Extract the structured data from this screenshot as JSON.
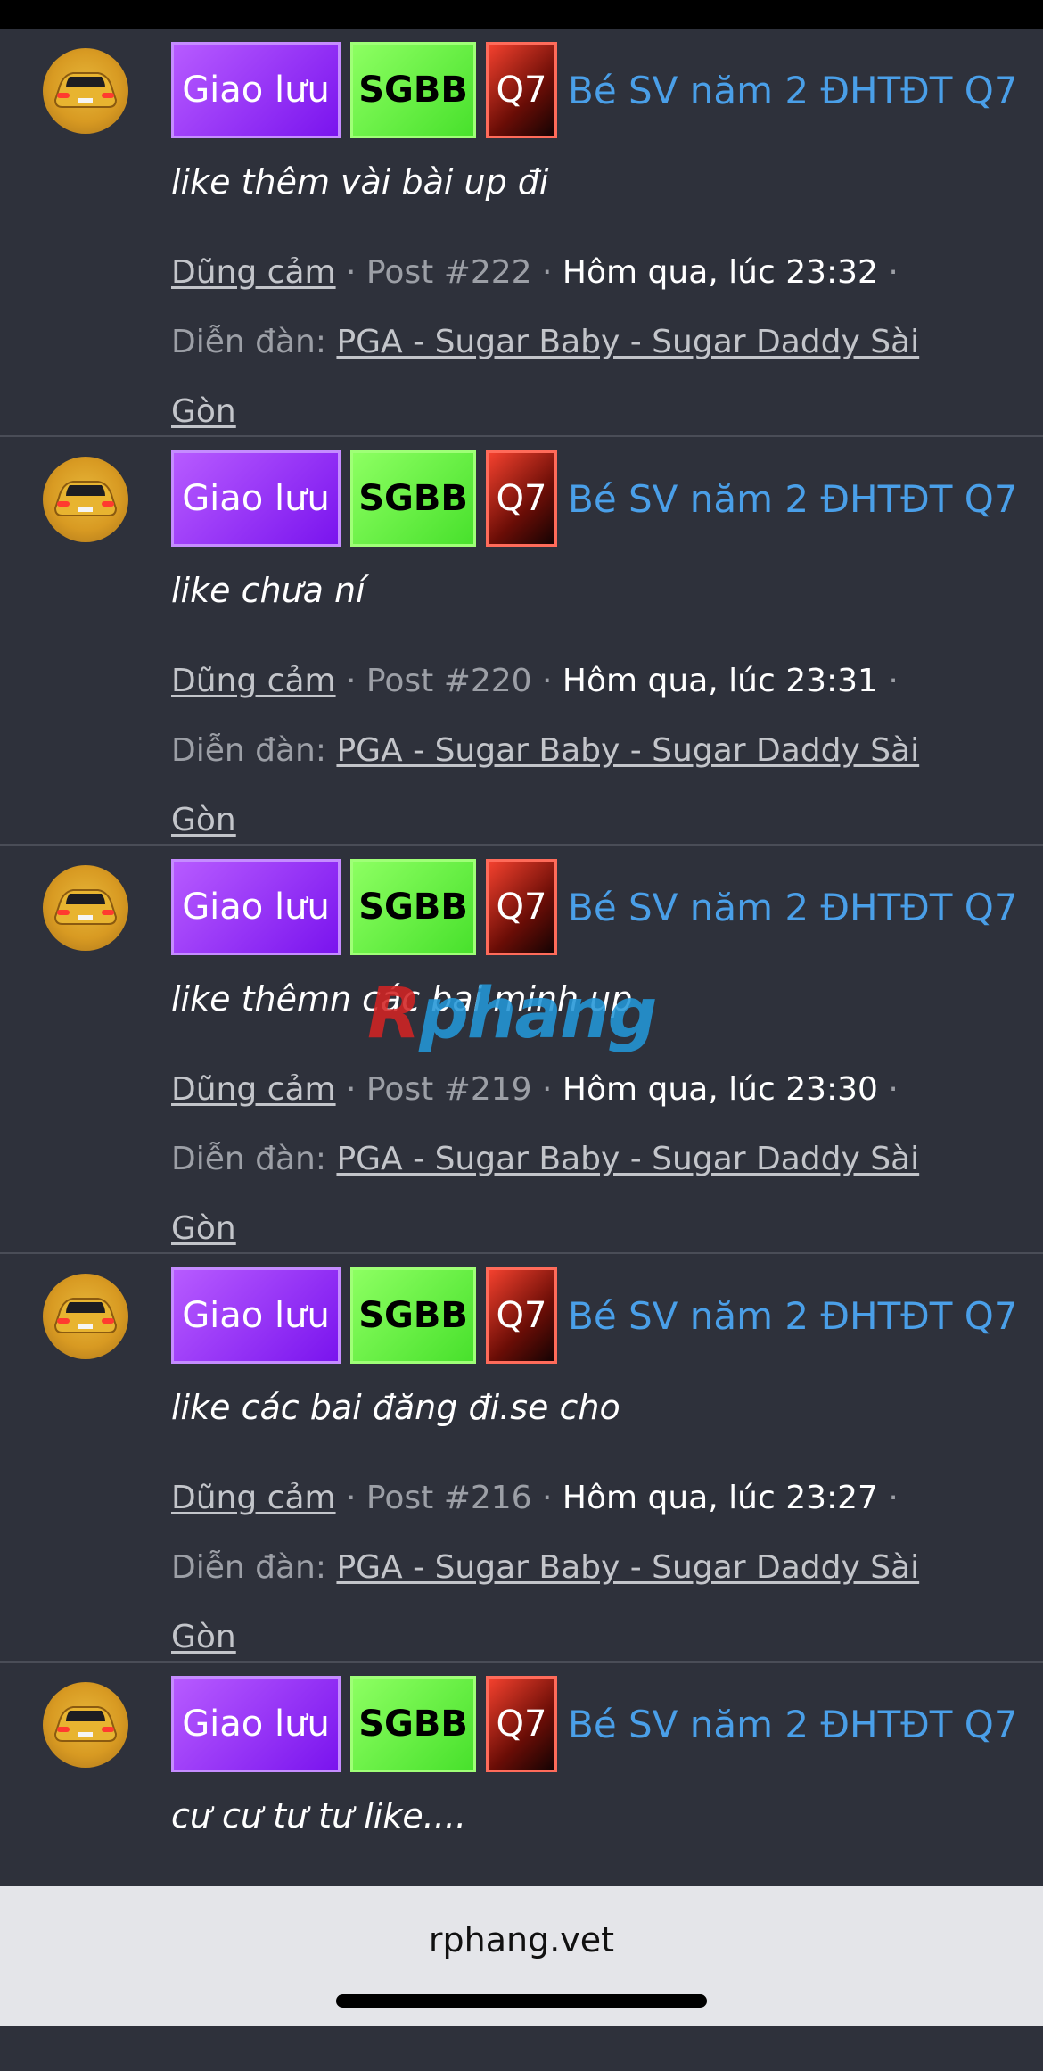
{
  "posts": [
    {
      "tags": [
        "Giao lưu",
        "SGBB",
        "Q7"
      ],
      "thread_title": "Bé SV năm 2 ĐHTĐT Q7",
      "snippet": "like thêm vài bài up đi",
      "author": "Dũng cảm",
      "post_number": "Post #222",
      "time": "Hôm qua, lúc 23:32",
      "forum_label": "Diễn đàn:",
      "forum_name": "PGA - Sugar Baby - Sugar Daddy Sài Gòn"
    },
    {
      "tags": [
        "Giao lưu",
        "SGBB",
        "Q7"
      ],
      "thread_title": "Bé SV năm 2 ĐHTĐT Q7",
      "snippet": "like chưa ní",
      "author": "Dũng cảm",
      "post_number": "Post #220",
      "time": "Hôm qua, lúc 23:31",
      "forum_label": "Diễn đàn:",
      "forum_name": "PGA - Sugar Baby - Sugar Daddy Sài Gòn"
    },
    {
      "tags": [
        "Giao lưu",
        "SGBB",
        "Q7"
      ],
      "thread_title": "Bé SV năm 2 ĐHTĐT Q7",
      "snippet": "like thêmn các bai minh up",
      "author": "Dũng cảm",
      "post_number": "Post #219",
      "time": "Hôm qua, lúc 23:30",
      "forum_label": "Diễn đàn:",
      "forum_name": "PGA - Sugar Baby - Sugar Daddy Sài Gòn"
    },
    {
      "tags": [
        "Giao lưu",
        "SGBB",
        "Q7"
      ],
      "thread_title": "Bé SV năm 2 ĐHTĐT Q7",
      "snippet": "like các bai đăng đi.se cho",
      "author": "Dũng cảm",
      "post_number": "Post #216",
      "time": "Hôm qua, lúc 23:27",
      "forum_label": "Diễn đàn:",
      "forum_name": "PGA - Sugar Baby - Sugar Daddy Sài Gòn"
    },
    {
      "tags": [
        "Giao lưu",
        "SGBB",
        "Q7"
      ],
      "thread_title": "Bé SV năm 2 ĐHTĐT Q7",
      "snippet": "cư cư tư tư like...."
    }
  ],
  "watermark": {
    "part1": "R",
    "part2": "phang"
  },
  "browser": {
    "url": "rphang.vet"
  },
  "colors": {
    "background": "#2e313b",
    "link": "#4a9fe8",
    "tag_giao_luu": "#8a2be2",
    "tag_sgbb": "#5ef03a",
    "tag_q7": "#c0271b"
  }
}
